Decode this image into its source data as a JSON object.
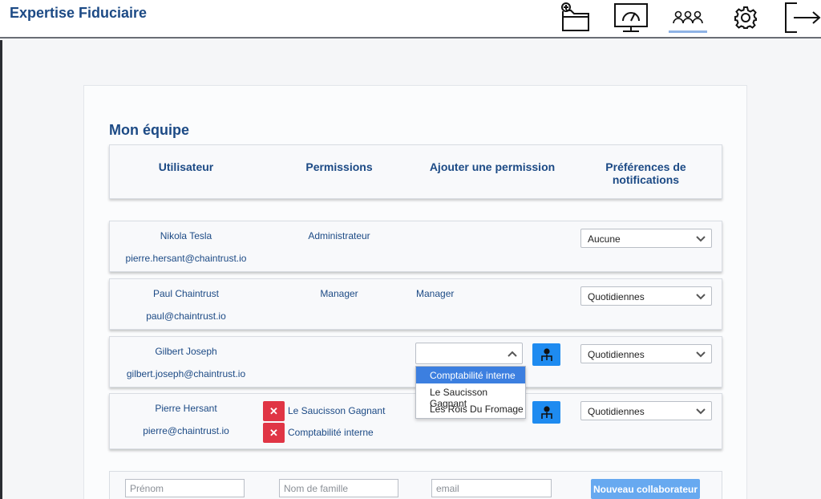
{
  "app": {
    "brand": "Expertise Fiduciaire"
  },
  "nav": {
    "items": [
      {
        "icon": "folder-add-icon"
      },
      {
        "icon": "dashboard-monitor-icon"
      },
      {
        "icon": "users-group-icon",
        "active": true
      },
      {
        "icon": "gear-icon"
      },
      {
        "icon": "logout-icon"
      }
    ]
  },
  "page": {
    "title": "Mon équipe"
  },
  "table": {
    "headers": {
      "user": "Utilisateur",
      "permissions": "Permissions",
      "add_permission": "Ajouter une permission",
      "notif_line1": "Préférences de",
      "notif_line2": "notifications"
    },
    "rows": [
      {
        "name": "Nikola Tesla",
        "email": "pierre.hersant@chaintrust.io",
        "permission": "Administrateur",
        "added": "",
        "notification": "Aucune"
      },
      {
        "name": "Paul Chaintrust",
        "email": "paul@chaintrust.io",
        "permission": "Manager",
        "added": "Manager",
        "notification": "Quotidiennes"
      },
      {
        "name": "Gilbert Joseph",
        "email": "gilbert.joseph@chaintrust.io",
        "permission": "",
        "added": "",
        "notification": "Quotidiennes"
      },
      {
        "name": "Pierre Hersant",
        "email": "pierre@chaintrust.io",
        "chips": [
          "Le Saucisson Gagnant",
          "Comptabilité interne"
        ],
        "chip_remove": "✕",
        "notification": "Quotidiennes"
      }
    ]
  },
  "permission_dropdown": {
    "value": "",
    "options": [
      "Comptabilité interne",
      "Le Saucisson Gagnant",
      "Les Rois Du Fromage"
    ],
    "highlighted": "Comptabilité interne"
  },
  "new_collaborator": {
    "firstname_placeholder": "Prénom",
    "lastname_placeholder": "Nom de famille",
    "email_placeholder": "email",
    "submit_label": "Nouveau collaborateur"
  },
  "colors": {
    "brand": "#1c4a85",
    "primary": "#1e8bf0",
    "danger": "#e03545",
    "highlight": "#3c7fe0"
  }
}
